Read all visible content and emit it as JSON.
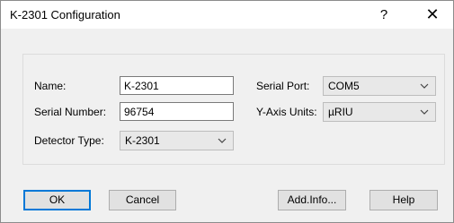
{
  "window": {
    "title": "K-2301 Configuration",
    "help_glyph": "?",
    "close_glyph": "✕"
  },
  "form": {
    "name_label": "Name:",
    "name_value": "K-2301",
    "serial_number_label": "Serial Number:",
    "serial_number_value": "96754",
    "detector_type_label": "Detector Type:",
    "detector_type_value": "K-2301",
    "serial_port_label": "Serial Port:",
    "serial_port_value": "COM5",
    "y_axis_units_label": "Y-Axis Units:",
    "y_axis_units_value": "µRIU"
  },
  "buttons": {
    "ok": "OK",
    "cancel": "Cancel",
    "add_info": "Add.Info...",
    "help": "Help"
  },
  "icons": {
    "dropdown": "chevron-down-icon"
  }
}
